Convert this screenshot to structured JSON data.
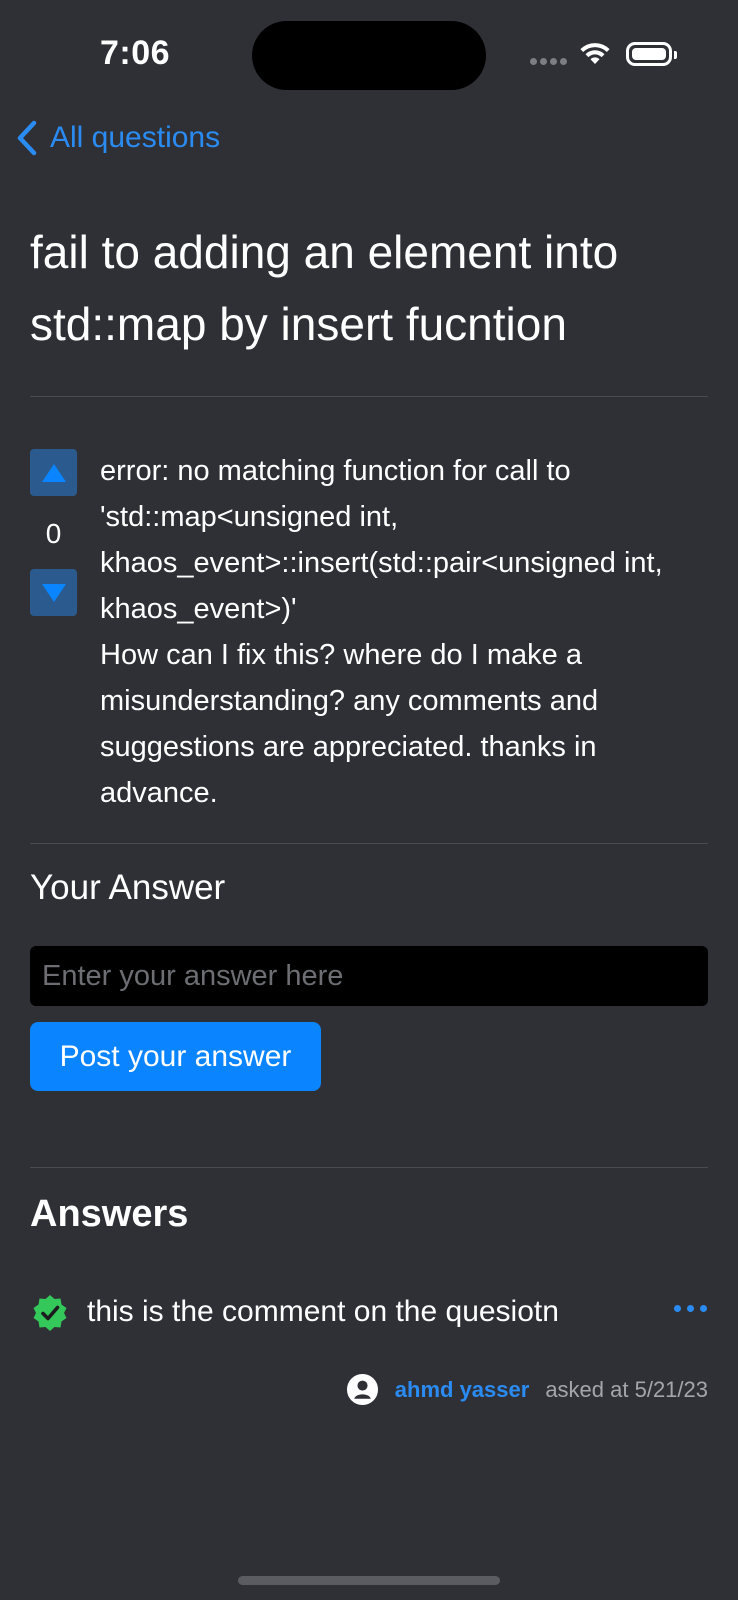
{
  "status_bar": {
    "time": "7:06"
  },
  "nav": {
    "back_label": "All questions"
  },
  "question": {
    "title": "fail to adding an element into std::map by insert fucntion",
    "vote_count": "0",
    "body": "error: no matching function for call to 'std::map<unsigned int, khaos_event>::insert(std::pair<unsigned int, khaos_event>)'\nHow can I fix this? where do I make a misunderstanding? any comments and suggestions are appreciated. thanks in advance."
  },
  "answer_form": {
    "heading": "Your Answer",
    "placeholder": "Enter your answer here",
    "value": "",
    "submit_label": "Post your answer"
  },
  "answers": {
    "heading": "Answers",
    "items": [
      {
        "text": "this is the comment on the quesiotn",
        "accepted": true,
        "author": "ahmd yasser",
        "asked_label": "asked at 5/21/23"
      }
    ]
  },
  "colors": {
    "background": "#2f3036",
    "accent": "#0a84ff",
    "link": "#2a8cf3",
    "accepted": "#34c759",
    "vote_button": "#2b5a8f"
  },
  "icons": [
    "chevron-left-icon",
    "triangle-up-icon",
    "triangle-down-icon",
    "check-badge-icon",
    "ellipsis-icon",
    "person-circle-icon",
    "wifi-icon",
    "battery-icon"
  ]
}
